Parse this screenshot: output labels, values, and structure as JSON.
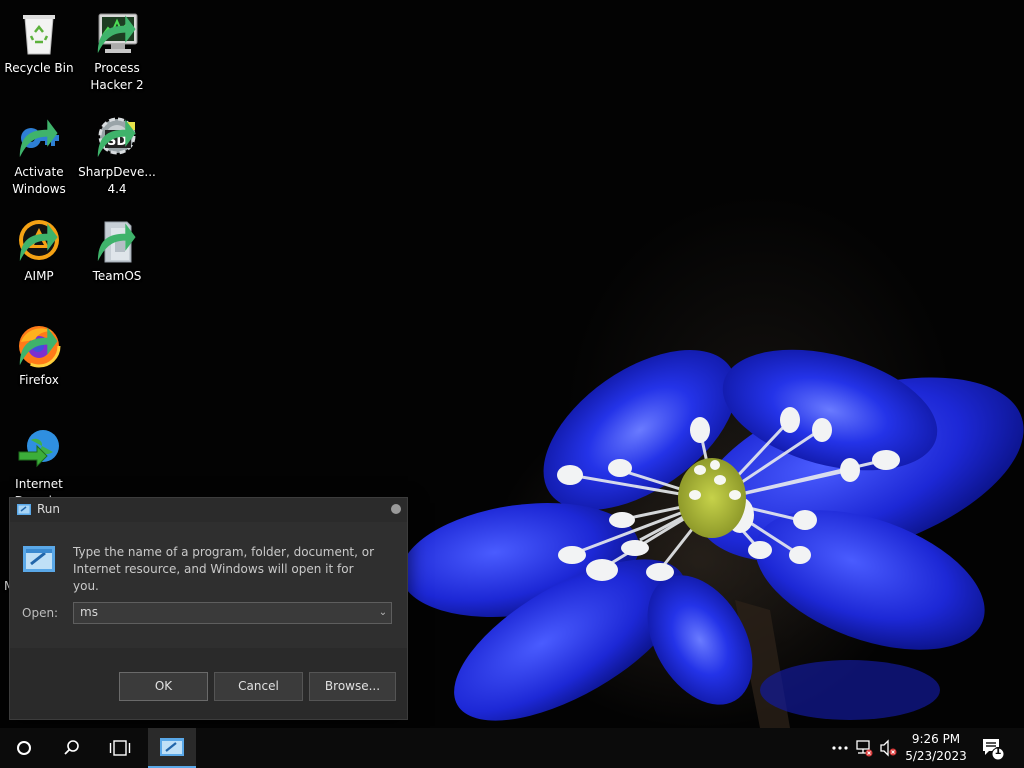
{
  "desktop": {
    "icons": [
      {
        "label": "Recycle Bin",
        "icon": "recycle-bin-icon"
      },
      {
        "label": "Process Hacker 2",
        "icon": "process-hacker-icon"
      },
      {
        "label": "Activate Windows",
        "icon": "key-icon"
      },
      {
        "label": "SharpDeve... 4.4",
        "icon": "sharpdevelop-icon"
      },
      {
        "label": "AIMP",
        "icon": "aimp-icon"
      },
      {
        "label": "TeamOS",
        "icon": "teamos-icon"
      },
      {
        "label": "Firefox",
        "icon": "firefox-icon"
      },
      {
        "label": "Internet Downl...",
        "icon": "internet-download-manager-icon"
      }
    ],
    "stray_text": "M"
  },
  "run_dialog": {
    "title": "Run",
    "description": "Type the name of a program, folder, document, or Internet resource, and Windows will open it for you.",
    "open_label": "Open:",
    "open_value": "ms",
    "ok_label": "OK",
    "cancel_label": "Cancel",
    "browse_label": "Browse..."
  },
  "taskbar": {
    "buttons": [
      "start-icon",
      "search-icon",
      "task-view-icon",
      "run-app-icon"
    ],
    "tray": [
      "overflow-icon",
      "network-icon",
      "volume-muted-icon"
    ],
    "time": "9:26 PM",
    "date": "5/23/2023",
    "notification_count": "1"
  },
  "colors": {
    "dialog_bg": "#2b2b2b",
    "taskbar_bg": "#0b0b0b",
    "accent": "#5aa8e8",
    "flower_blue": "#1f2de0"
  }
}
